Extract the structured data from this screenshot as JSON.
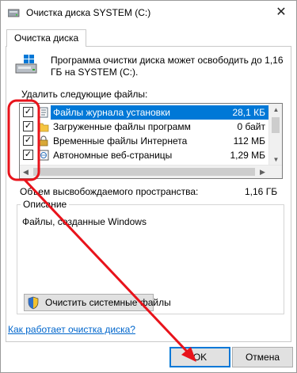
{
  "window": {
    "title": "Очистка диска SYSTEM (C:)",
    "close_symbol": "✕"
  },
  "tabs": [
    {
      "label": "Очистка диска"
    }
  ],
  "intro": {
    "text": "Программа очистки диска может освободить до 1,16 ГБ на SYSTEM (C:)."
  },
  "files": {
    "label": "Удалить следующие файлы:",
    "items": [
      {
        "name": "Файлы журнала установки",
        "size": "28,1 КБ",
        "checked": true,
        "selected": true,
        "icon": "log-file-icon"
      },
      {
        "name": "Загруженные файлы программ",
        "size": "0 байт",
        "checked": true,
        "selected": false,
        "icon": "folder-icon"
      },
      {
        "name": "Временные файлы Интернета",
        "size": "112 МБ",
        "checked": true,
        "selected": false,
        "icon": "lock-icon"
      },
      {
        "name": "Автономные веб-страницы",
        "size": "1,29 МБ",
        "checked": true,
        "selected": false,
        "icon": "web-page-icon"
      }
    ],
    "check_symbol": "✓"
  },
  "space": {
    "label": "Объем высвобождаемого пространства:",
    "value": "1,16 ГБ"
  },
  "description": {
    "title": "Описание",
    "text": "Файлы, созданные Windows"
  },
  "buttons": {
    "clean_system": "Очистить системные файлы",
    "ok": "OK",
    "cancel": "Отмена"
  },
  "help_link": "Как работает очистка диска?",
  "colors": {
    "selection": "#0078d7",
    "annotation": "#e8131b",
    "link": "#0066cc"
  }
}
